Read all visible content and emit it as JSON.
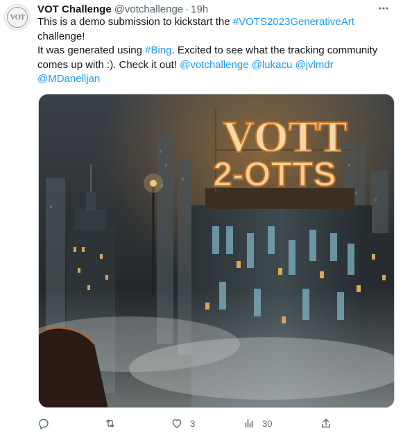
{
  "author": {
    "avatar_text": "VOT",
    "display_name": "VOT Challenge",
    "handle": "@votchallenge",
    "separator": "·",
    "time": "19h"
  },
  "more_icon": "more-horizontal-icon",
  "tweet": {
    "text_1": "This is a demo submission to kickstart the ",
    "hashtag_1": "#VOTS2023GenerativeArt",
    "text_2": " challenge!",
    "text_3": "It was generated using ",
    "hashtag_2": "#Bing",
    "text_4": ". Excited to see what the tracking community comes up with :). Check it out! ",
    "mention_1": "@votchallenge",
    "mention_2": "@lukacu",
    "mention_3": "@jvlmdr",
    "mention_4": "@MDanelljan"
  },
  "image": {
    "sign_line_1": "VOTT",
    "sign_line_2": "2-OTTS"
  },
  "actions": {
    "reply": {
      "icon": "reply-icon",
      "count": ""
    },
    "retweet": {
      "icon": "retweet-icon",
      "count": ""
    },
    "like": {
      "icon": "heart-icon",
      "count": "3"
    },
    "views": {
      "icon": "views-icon",
      "count": "30"
    },
    "share": {
      "icon": "share-icon",
      "count": ""
    }
  },
  "colors": {
    "link": "#1d9bf0",
    "secondary_text": "#536471",
    "primary_text": "#0f1419",
    "border": "#cfd9de"
  }
}
